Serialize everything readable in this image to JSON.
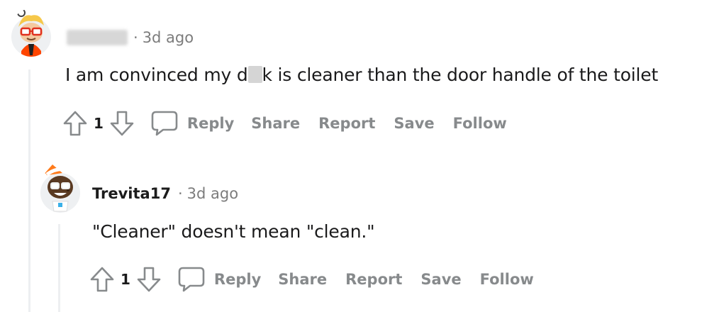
{
  "comments": [
    {
      "username_redacted": true,
      "separator": "·",
      "timestamp": "3d ago",
      "body_before": "I am convinced my d",
      "body_after": "k is cleaner than the door handle of the toilet",
      "votes": "1",
      "actions": {
        "reply": "Reply",
        "share": "Share",
        "report": "Report",
        "save": "Save",
        "follow": "Follow"
      }
    },
    {
      "username": "Trevita17",
      "separator": "·",
      "timestamp": "3d ago",
      "body": "\"Cleaner\" doesn't mean \"clean.\"",
      "votes": "1",
      "actions": {
        "reply": "Reply",
        "share": "Share",
        "report": "Report",
        "save": "Save",
        "follow": "Follow"
      }
    }
  ],
  "icons": {
    "upvote": "arrow-up-icon",
    "downvote": "arrow-down-icon",
    "reply": "speech-bubble-icon"
  },
  "colors": {
    "text": "#1a1a1b",
    "meta": "#7c7c7c",
    "action": "#878a8c",
    "thread_line": "#edeff1"
  }
}
